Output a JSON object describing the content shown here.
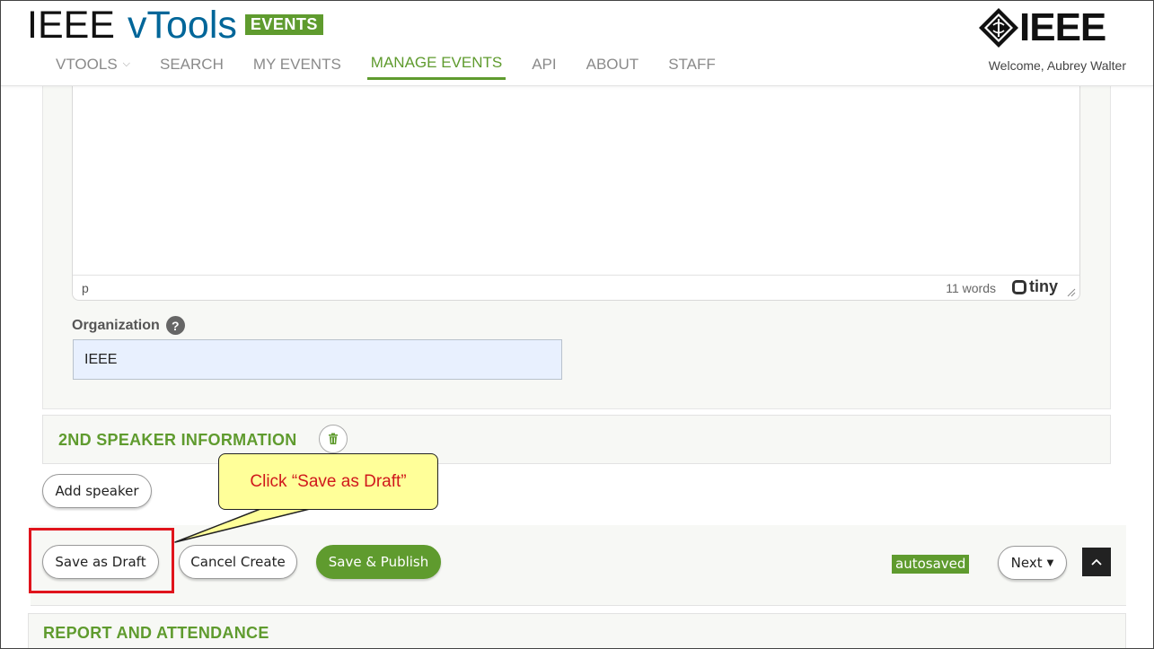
{
  "header": {
    "brand_ieee": "IEEE",
    "brand_vtools": "vTools",
    "brand_events": "EVENTS",
    "logo_text": "IEEE",
    "welcome": "Welcome, Aubrey Walter",
    "nav": [
      {
        "label": "VTOOLS"
      },
      {
        "label": "SEARCH"
      },
      {
        "label": "MY EVENTS"
      },
      {
        "label": "MANAGE EVENTS"
      },
      {
        "label": "API"
      },
      {
        "label": "ABOUT"
      },
      {
        "label": "STAFF"
      }
    ]
  },
  "editor": {
    "path": "p",
    "word_count": "11 words",
    "brand": "tiny"
  },
  "organization": {
    "label": "Organization",
    "help": "?",
    "value": "IEEE"
  },
  "speaker2": {
    "title": "2ND SPEAKER INFORMATION"
  },
  "buttons": {
    "add_speaker": "Add speaker",
    "save_draft": "Save as Draft",
    "cancel_create": "Cancel Create",
    "save_publish": "Save & Publish",
    "next": "Next"
  },
  "status": {
    "autosaved": "autosaved"
  },
  "report": {
    "title": "REPORT AND ATTENDANCE"
  },
  "annotation": {
    "callout_text": "Click “Save as Draft”"
  },
  "colors": {
    "accent_green": "#5f9b2e",
    "vtools_blue": "#006699",
    "callout_yellow": "#ffff99",
    "highlight_red": "#e0141c"
  }
}
